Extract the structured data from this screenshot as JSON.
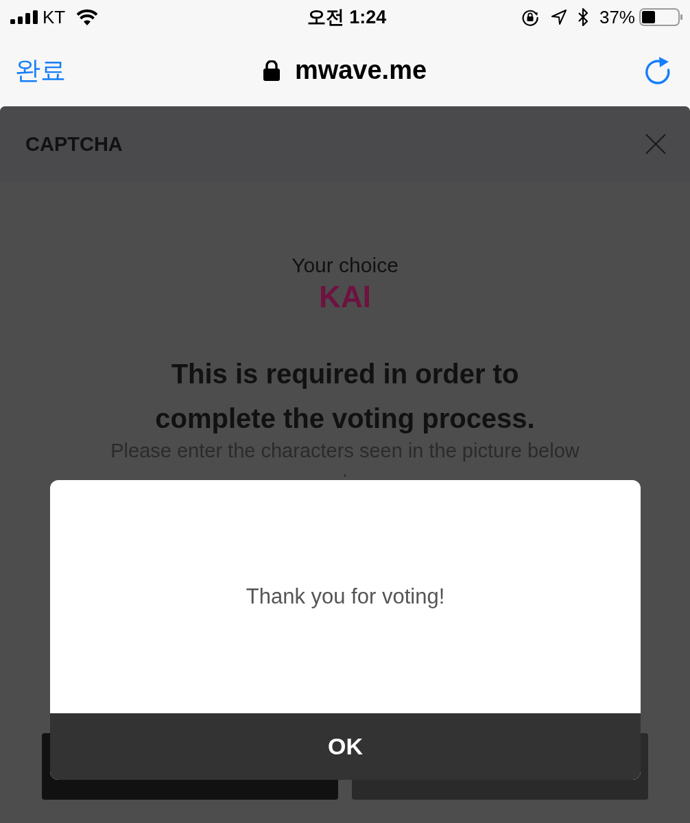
{
  "status_bar": {
    "carrier": "KT",
    "time": "오전 1:24",
    "battery": "37%"
  },
  "browser_bar": {
    "done": "완료",
    "url": "mwave.me"
  },
  "modal": {
    "title": "CAPTCHA",
    "choice_label": "Your choice",
    "choice": "KAI",
    "heading": "This is required in order to complete the voting process.",
    "instruction": "Please enter the characters seen in the picture below .",
    "buttons": [
      {
        "kind": "primary"
      },
      {
        "kind": "secondary"
      }
    ]
  },
  "alert": {
    "message": "Thank you for voting!",
    "button": "OK"
  }
}
